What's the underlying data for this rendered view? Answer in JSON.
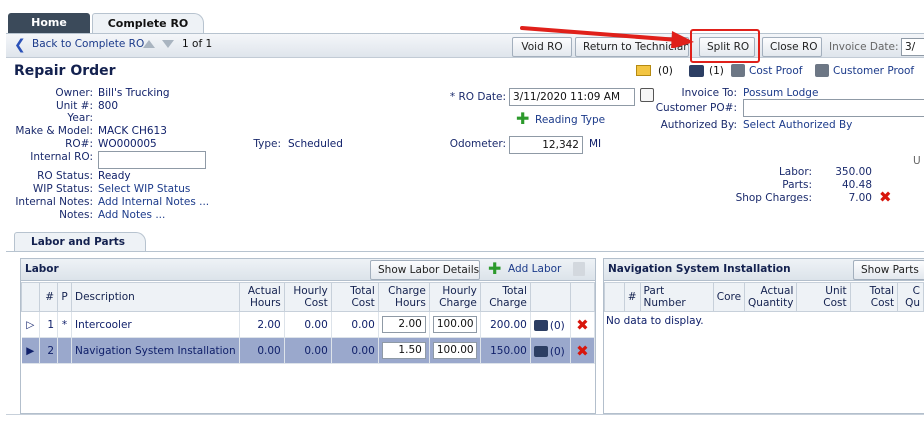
{
  "tabs": {
    "home": "Home",
    "complete_ro": "Complete RO"
  },
  "toolbar": {
    "back_label": "Back to Complete RO",
    "pager": "1 of 1",
    "void_ro": "Void RO",
    "return_to_tech": "Return to Technician",
    "split_ro": "Split RO",
    "close_ro": "Close RO",
    "invoice_date_label": "Invoice Date:",
    "invoice_date_value": "3/"
  },
  "header": {
    "title": "Repair Order",
    "email_count": "(0)",
    "photo_count": "(1)",
    "cost_proof": "Cost Proof",
    "customer_proof": "Customer Proof"
  },
  "fields": {
    "owner_label": "Owner:",
    "owner": "Bill's Trucking",
    "unit_label": "Unit #:",
    "unit": "800",
    "year_label": "Year:",
    "year": "",
    "make_label": "Make & Model:",
    "make": "MACK CH613",
    "ro_label": "RO#:",
    "ro": "WO000005",
    "internal_ro_label": "Internal RO:",
    "internal_ro": "",
    "type_label": "Type:",
    "type": "Scheduled",
    "ro_status_label": "RO Status:",
    "ro_status": "Ready",
    "wip_label": "WIP Status:",
    "wip": "Select WIP Status",
    "internal_notes_label": "Internal Notes:",
    "internal_notes": "Add Internal Notes ...",
    "notes_label": "Notes:",
    "notes": "Add Notes ...",
    "ro_date_label": "* RO Date:",
    "ro_date": "3/11/2020 11:09 AM",
    "reading_type": "Reading Type",
    "odometer_label": "Odometer:",
    "odometer": "12,342",
    "odometer_unit": "MI",
    "invoice_to_label": "Invoice To:",
    "invoice_to": "Possum Lodge",
    "customer_po_label": "Customer PO#:",
    "customer_po": "",
    "authorized_label": "Authorized By:",
    "authorized": "Select Authorized By",
    "u_char": "U"
  },
  "totals": {
    "labor_label": "Labor:",
    "labor": "350.00",
    "parts_label": "Parts:",
    "parts": "40.48",
    "shop_label": "Shop Charges:",
    "shop": "7.00"
  },
  "section_tab": "Labor and Parts",
  "labor_panel": {
    "title": "Labor",
    "show_details": "Show Labor Details",
    "add_labor": "Add Labor",
    "columns": [
      "#",
      "P",
      "Description",
      "Actual Hours",
      "Hourly Cost",
      "Total Cost",
      "Charge Hours",
      "Hourly Charge",
      "Total Charge"
    ],
    "rows": [
      {
        "num": "1",
        "p": "*",
        "desc": "Intercooler",
        "actual": "2.00",
        "hcost": "0.00",
        "tcost": "0.00",
        "chours": "2.00",
        "hcharge": "100.00",
        "tcharge": "200.00",
        "photos": "(0)"
      },
      {
        "num": "2",
        "p": "",
        "desc": "Navigation System Installation",
        "actual": "0.00",
        "hcost": "0.00",
        "tcost": "0.00",
        "chours": "1.50",
        "hcharge": "100.00",
        "tcharge": "150.00",
        "photos": "(0)"
      }
    ]
  },
  "parts_panel": {
    "title": "Navigation System Installation",
    "show_parts": "Show Parts",
    "columns": [
      "#",
      "Part Number",
      "Core",
      "Actual Quantity",
      "Unit Cost",
      "Total Cost",
      "C Qu"
    ],
    "empty": "No data to display."
  },
  "colors": {
    "highlight": "#e0201a",
    "selected_row": "#9aa8cc",
    "tab_dark": "#3b4a5a"
  }
}
